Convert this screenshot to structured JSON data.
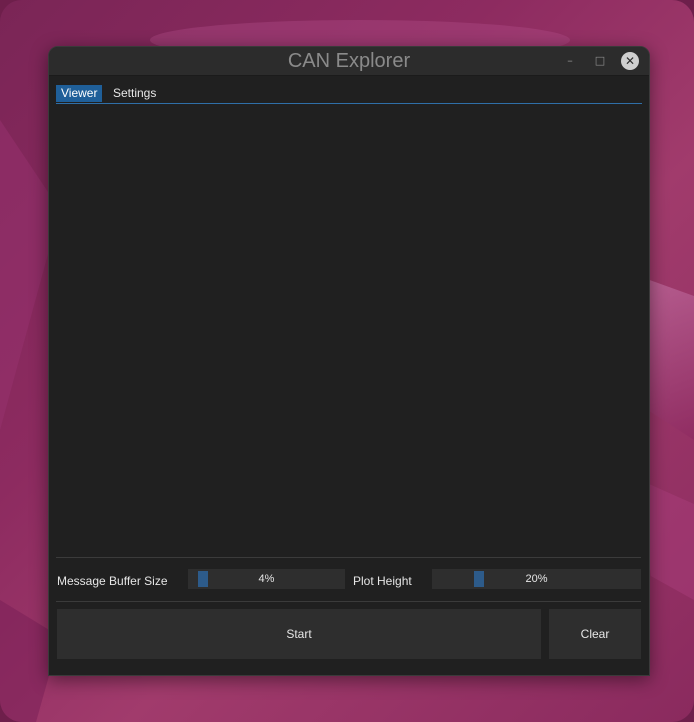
{
  "window": {
    "title": "CAN Explorer",
    "controls": {
      "minimize": "–",
      "maximize": "□",
      "close": "✕"
    }
  },
  "tabs": [
    {
      "label": "Viewer",
      "active": true
    },
    {
      "label": "Settings",
      "active": false
    }
  ],
  "controls": {
    "buffer": {
      "label": "Message Buffer Size",
      "value_text": "4%",
      "value": 0.04
    },
    "plot_height": {
      "label": "Plot Height",
      "value_text": "20%",
      "value": 0.2
    }
  },
  "buttons": {
    "start": "Start",
    "clear": "Clear"
  },
  "colors": {
    "accent": "#1f5f99",
    "grab": "#2d5b8a",
    "window_bg": "#202020"
  }
}
